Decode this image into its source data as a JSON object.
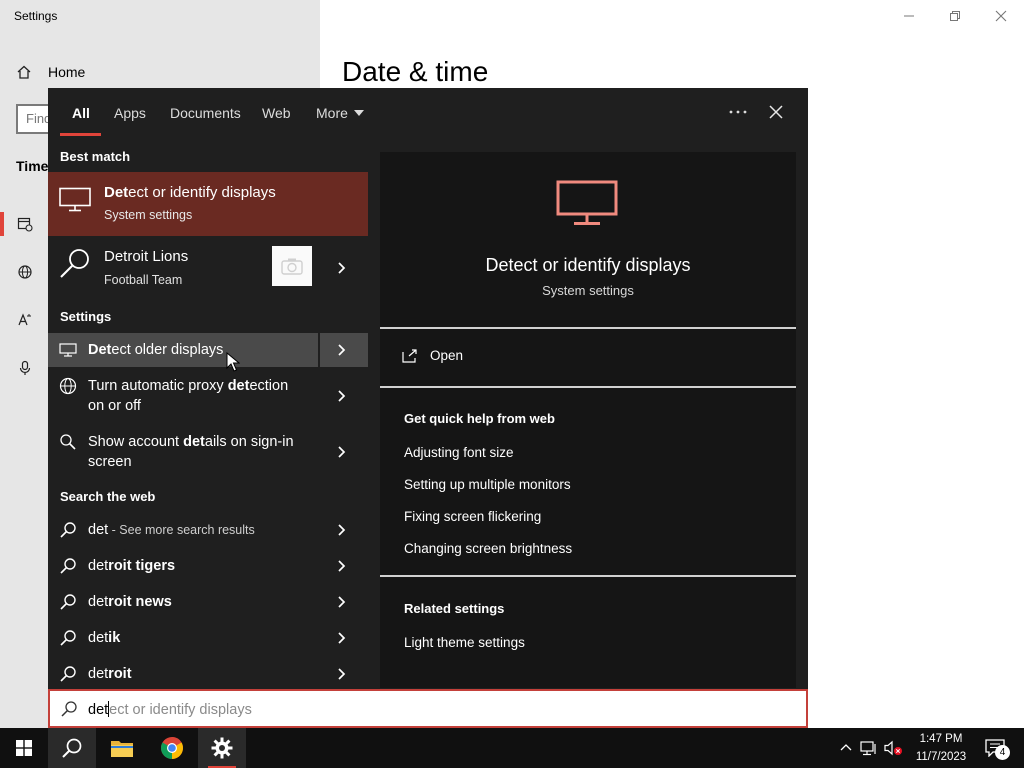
{
  "settings": {
    "window_title": "Settings",
    "home_label": "Home",
    "find_placeholder": "Find",
    "section_label": "Time",
    "page_title": "Date & time"
  },
  "search": {
    "tabs": [
      {
        "label": "All"
      },
      {
        "label": "Apps"
      },
      {
        "label": "Documents"
      },
      {
        "label": "Web"
      },
      {
        "label": "More"
      }
    ],
    "options_icon": "more-dots-icon",
    "groups": {
      "best_match": "Best match",
      "settings": "Settings",
      "web": "Search the web"
    },
    "best_match": {
      "title_bold": "Det",
      "title_rest": "ect or identify displays",
      "subtitle": "System settings",
      "icon": "monitor-icon"
    },
    "suggestion": {
      "title": "Detroit Lions",
      "subtitle": "Football Team"
    },
    "settings_results": [
      {
        "pre": "",
        "bold": "Det",
        "post": "ect older displays",
        "icon": "monitor-icon"
      },
      {
        "pre": "Turn automatic proxy ",
        "bold": "det",
        "post": "ection",
        "line2": "on or off",
        "icon": "globe-icon"
      },
      {
        "pre": "Show account ",
        "bold": "det",
        "post": "ails on sign-in",
        "line2": "screen",
        "icon": "person-search-icon"
      }
    ],
    "web_results": [
      {
        "query": "det",
        "more": " - See more search results"
      },
      {
        "pre": "det",
        "bold": "roit tigers"
      },
      {
        "pre": "det",
        "bold": "roit news"
      },
      {
        "pre": "det",
        "bold": "ik"
      },
      {
        "pre": "det",
        "bold": "roit"
      }
    ],
    "preview": {
      "title": "Detect or identify displays",
      "subtitle": "System settings",
      "open_label": "Open",
      "help_heading": "Get quick help from web",
      "help_links": [
        "Adjusting font size",
        "Setting up multiple monitors",
        "Fixing screen flickering",
        "Changing screen brightness"
      ],
      "related_heading": "Related settings",
      "related_links": [
        "Light theme settings"
      ]
    },
    "query": {
      "typed": "det",
      "ghost": "ect or identify displays"
    }
  },
  "taskbar": {
    "time": "1:47 PM",
    "date": "11/7/2023",
    "notification_count": "4"
  },
  "colors": {
    "accent": "#e0443a",
    "best_match_bg": "#6a2a22",
    "panel_bg": "#1f1f1f",
    "preview_bg": "#151515"
  }
}
